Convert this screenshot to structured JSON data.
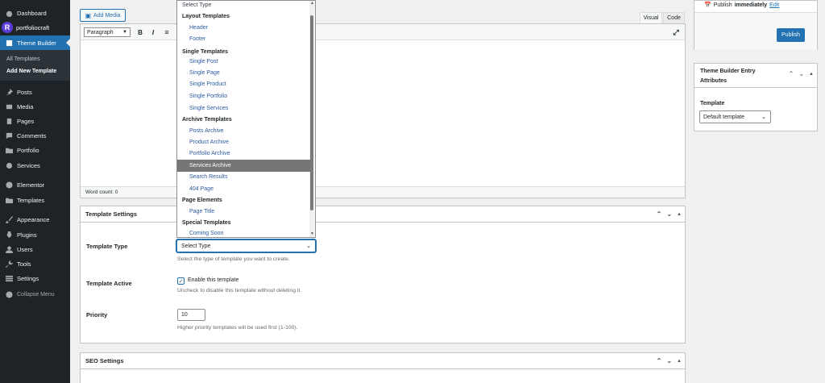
{
  "sidebar": {
    "items": [
      {
        "label": "Dashboard",
        "icon": "dashboard-icon"
      },
      {
        "label": "portfoliocraft",
        "icon": "portfoliocraft-logo"
      },
      {
        "label": "Theme Builder",
        "icon": "theme-builder-icon"
      },
      {
        "label": "Posts",
        "icon": "pin-icon"
      },
      {
        "label": "Media",
        "icon": "media-icon"
      },
      {
        "label": "Pages",
        "icon": "pages-icon"
      },
      {
        "label": "Comments",
        "icon": "comments-icon"
      },
      {
        "label": "Portfolio",
        "icon": "folder-icon"
      },
      {
        "label": "Services",
        "icon": "gear-icon"
      },
      {
        "label": "Elementor",
        "icon": "elementor-icon"
      },
      {
        "label": "Templates",
        "icon": "folder-icon"
      },
      {
        "label": "Appearance",
        "icon": "brush-icon"
      },
      {
        "label": "Plugins",
        "icon": "plugin-icon"
      },
      {
        "label": "Users",
        "icon": "user-icon"
      },
      {
        "label": "Tools",
        "icon": "wrench-icon"
      },
      {
        "label": "Settings",
        "icon": "settings-icon"
      },
      {
        "label": "Collapse Menu",
        "icon": "collapse-icon"
      }
    ],
    "submenu": [
      "All Templates",
      "Add New Template"
    ],
    "logo_letter": "R"
  },
  "editor": {
    "add_media": "Add Media",
    "tab_visual": "Visual",
    "tab_code": "Code",
    "format": "Paragraph",
    "bold": "B",
    "italic": "I",
    "word_count": "Word count: 0"
  },
  "template_settings": {
    "title": "Template Settings",
    "type_label": "Template Type",
    "type_value": "Select Type",
    "type_desc": "Select the type of template you want to create.",
    "active_label": "Template Active",
    "active_checkbox": "Enable this template",
    "active_desc": "Uncheck to disable this template without deleting it.",
    "priority_label": "Priority",
    "priority_value": "10",
    "priority_desc": "Higher priority templates will be used first (1-100)."
  },
  "seo": {
    "title": "SEO Settings"
  },
  "dropdown": {
    "entries": [
      {
        "kind": "option",
        "label": "Select Type"
      },
      {
        "kind": "group",
        "label": "Layout Templates"
      },
      {
        "kind": "option",
        "label": "Header"
      },
      {
        "kind": "option",
        "label": "Footer"
      },
      {
        "kind": "group",
        "label": "Single Templates"
      },
      {
        "kind": "option",
        "label": "Single Post"
      },
      {
        "kind": "option",
        "label": "Single Page"
      },
      {
        "kind": "option",
        "label": "Single Product"
      },
      {
        "kind": "option",
        "label": "Single Portfolio"
      },
      {
        "kind": "option",
        "label": "Single Services"
      },
      {
        "kind": "group",
        "label": "Archive Templates"
      },
      {
        "kind": "option",
        "label": "Posts Archive"
      },
      {
        "kind": "option",
        "label": "Product Archive"
      },
      {
        "kind": "option",
        "label": "Portfolio Archive"
      },
      {
        "kind": "option",
        "label": "Services Archive",
        "highlighted": true
      },
      {
        "kind": "option",
        "label": "Search Results"
      },
      {
        "kind": "option",
        "label": "404 Page"
      },
      {
        "kind": "group",
        "label": "Page Elements"
      },
      {
        "kind": "option",
        "label": "Page Title"
      },
      {
        "kind": "group",
        "label": "Special Templates"
      },
      {
        "kind": "option",
        "label": "Coming Soon"
      }
    ]
  },
  "publish": {
    "text_prefix": "Publish",
    "text_bold": "immediately",
    "edit_link": "Edit",
    "button": "Publish"
  },
  "attributes": {
    "title_line1": "Theme Builder Entry",
    "title_line2": "Attributes",
    "template_label": "Template",
    "template_value": "Default template"
  },
  "colors": {
    "accent": "#2271b1",
    "sidebar": "#1d2327",
    "highlight": "#767676"
  }
}
